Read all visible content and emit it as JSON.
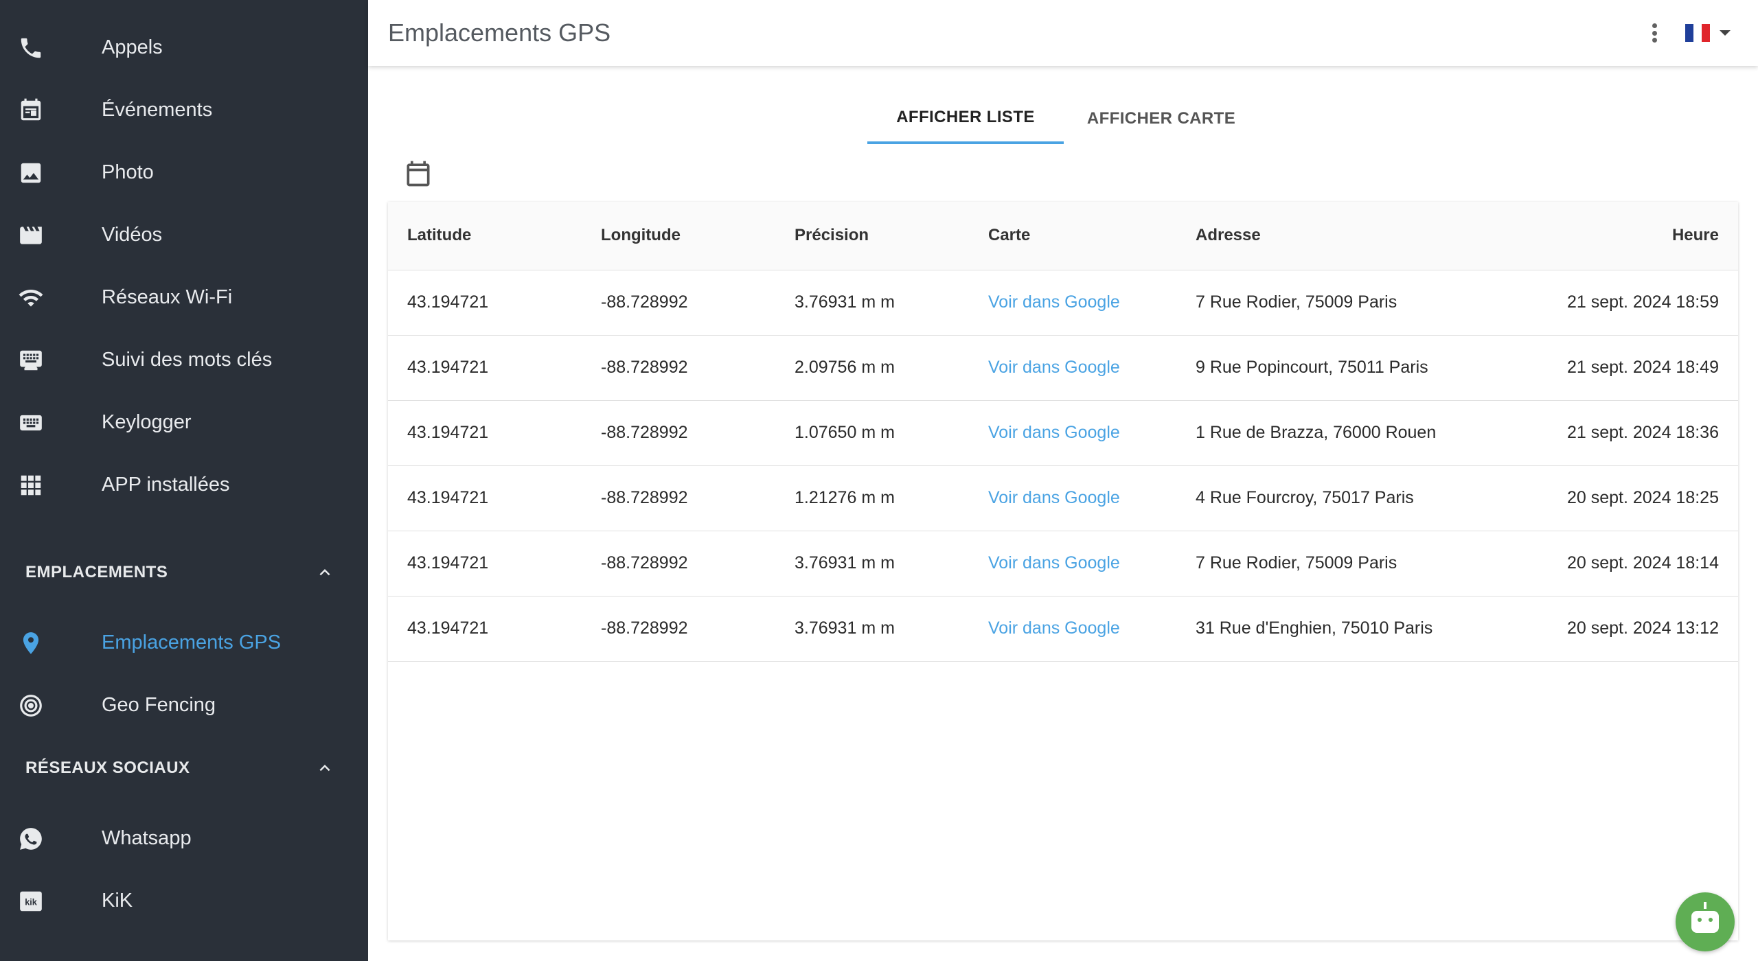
{
  "sidebar": {
    "items": [
      {
        "label": "Appels",
        "icon": "phone-icon"
      },
      {
        "label": "Événements",
        "icon": "calendar-event-icon"
      },
      {
        "label": "Photo",
        "icon": "image-icon"
      },
      {
        "label": "Vidéos",
        "icon": "movie-icon"
      },
      {
        "label": "Réseaux Wi-Fi",
        "icon": "wifi-icon"
      },
      {
        "label": "Suivi des mots clés",
        "icon": "keyboard-monitor-icon"
      },
      {
        "label": "Keylogger",
        "icon": "keyboard-icon"
      },
      {
        "label": "APP installées",
        "icon": "apps-grid-icon"
      }
    ],
    "sections": [
      {
        "title": "EMPLACEMENTS",
        "items": [
          {
            "label": "Emplacements GPS",
            "icon": "location-pin-icon",
            "active": true
          },
          {
            "label": "Geo Fencing",
            "icon": "target-icon"
          }
        ]
      },
      {
        "title": "RÉSEAUX SOCIAUX",
        "items": [
          {
            "label": "Whatsapp",
            "icon": "whatsapp-icon"
          },
          {
            "label": "KiK",
            "icon": "kik-icon"
          }
        ]
      }
    ]
  },
  "topbar": {
    "title": "Emplacements GPS",
    "language_flag": "french-flag-icon"
  },
  "tabs": [
    {
      "label": "AFFICHER LISTE",
      "active": true
    },
    {
      "label": "AFFICHER CARTE",
      "active": false
    }
  ],
  "table": {
    "columns": [
      "Latitude",
      "Longitude",
      "Précision",
      "Carte",
      "Adresse",
      "Heure"
    ],
    "rows": [
      {
        "lat": "43.194721",
        "lng": "-88.728992",
        "precision": "3.76931 m m",
        "map": "Voir dans Google",
        "address": "7 Rue Rodier, 75009 Paris",
        "time": "21 sept. 2024 18:59"
      },
      {
        "lat": "43.194721",
        "lng": "-88.728992",
        "precision": "2.09756 m m",
        "map": "Voir dans Google",
        "address": "9 Rue Popincourt, 75011 Paris",
        "time": "21 sept. 2024 18:49"
      },
      {
        "lat": "43.194721",
        "lng": "-88.728992",
        "precision": "1.07650 m m",
        "map": "Voir dans Google",
        "address": "1 Rue de Brazza, 76000 Rouen",
        "time": "21 sept. 2024 18:36"
      },
      {
        "lat": "43.194721",
        "lng": "-88.728992",
        "precision": "1.21276 m m",
        "map": "Voir dans Google",
        "address": "4 Rue Fourcroy, 75017 Paris",
        "time": "20 sept. 2024 18:25"
      },
      {
        "lat": "43.194721",
        "lng": "-88.728992",
        "precision": "3.76931 m m",
        "map": "Voir dans Google",
        "address": "7 Rue Rodier, 75009 Paris",
        "time": "20 sept. 2024 18:14"
      },
      {
        "lat": "43.194721",
        "lng": "-88.728992",
        "precision": "3.76931 m m",
        "map": "Voir dans Google",
        "address": "31 Rue d'Enghien, 75010 Paris",
        "time": "20 sept. 2024 13:12"
      }
    ]
  },
  "colors": {
    "sidebar_bg": "#2a3039",
    "accent": "#4aa3e3",
    "bot_button": "#5fae54"
  }
}
